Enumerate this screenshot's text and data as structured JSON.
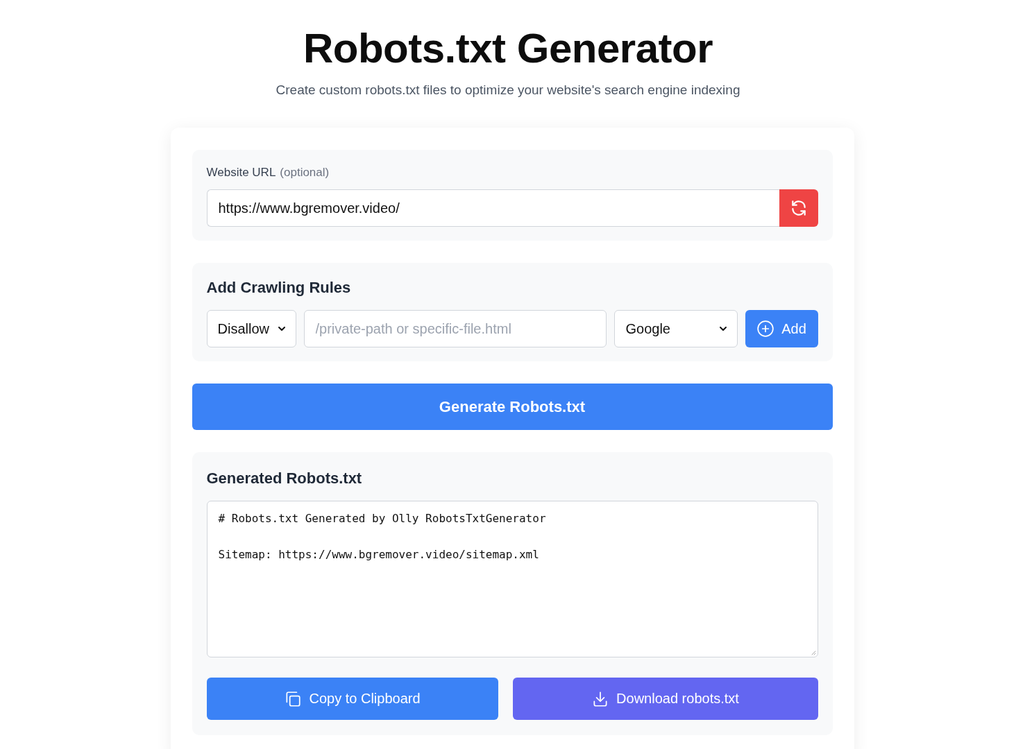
{
  "header": {
    "title": "Robots.txt Generator",
    "subtitle": "Create custom robots.txt files to optimize your website's search engine indexing"
  },
  "url_section": {
    "label": "Website URL",
    "label_note": "(optional)",
    "value": "https://www.bgremover.video/"
  },
  "rules_section": {
    "heading": "Add Crawling Rules",
    "rule_type": "Disallow",
    "path_placeholder": "/private-path or specific-file.html",
    "user_agent": "Google",
    "add_button": "Add"
  },
  "generate_button": "Generate Robots.txt",
  "output_section": {
    "heading": "Generated Robots.txt",
    "text": "# Robots.txt Generated by Olly RobotsTxtGenerator\n\nSitemap: https://www.bgremover.video/sitemap.xml"
  },
  "actions": [
    {
      "kind": "copy",
      "label": "Copy to Clipboard"
    },
    {
      "kind": "download",
      "label": "Download robots.txt"
    }
  ]
}
